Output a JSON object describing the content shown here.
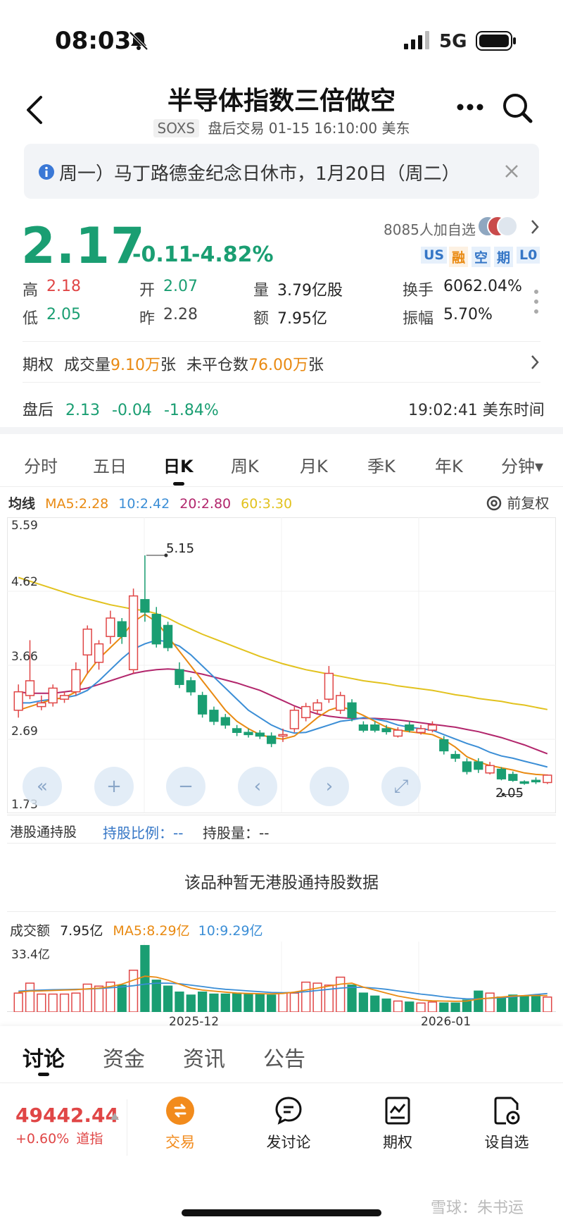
{
  "status": {
    "time": "08:03",
    "network": "5G"
  },
  "header": {
    "title": "半导体指数三倍做空",
    "ticker": "SOXS",
    "session_info": "盘后交易 01-15 16:10:00 美东"
  },
  "notice": {
    "text": "周一）马丁路德金纪念日休市，1月20日（周二）"
  },
  "quote": {
    "price": "2.17",
    "change": "-0.11",
    "change_pct": "-4.82%",
    "followers": "8085人加自选",
    "tags": [
      "US",
      "融",
      "空",
      "期",
      "L0"
    ]
  },
  "stats": {
    "high_label": "高",
    "high": "2.18",
    "open_label": "开",
    "open": "2.07",
    "volume_label": "量",
    "volume": "3.79亿股",
    "turnover_label": "换手",
    "turnover": "6062.04%",
    "low_label": "低",
    "low": "2.05",
    "prev_label": "昨",
    "prev": "2.28",
    "amount_label": "额",
    "amount": "7.95亿",
    "amplitude_label": "振幅",
    "amplitude": "5.70%"
  },
  "options": {
    "label": "期权",
    "vol_label": "成交量",
    "vol": "9.10万",
    "vol_unit": "张",
    "oi_label": "未平仓数",
    "oi": "76.00万",
    "oi_unit": "张"
  },
  "after_hours": {
    "label": "盘后",
    "price": "2.13",
    "change": "-0.04",
    "change_pct": "-1.84%",
    "time": "19:02:41 美东时间"
  },
  "period_tabs": [
    "分时",
    "五日",
    "日K",
    "周K",
    "月K",
    "季K",
    "年K",
    "分钟▾"
  ],
  "ma_legend": {
    "label": "均线",
    "ma5": "MA5:2.28",
    "ma10": "10:2.42",
    "ma20": "20:2.80",
    "ma60": "60:3.30",
    "adjust": "前复权"
  },
  "price_axis": [
    "5.59",
    "4.62",
    "3.66",
    "2.69",
    "1.73"
  ],
  "annotations": {
    "high": "5.15",
    "low": "2.05"
  },
  "hk_connect": {
    "label": "港股通持股",
    "ratio_label": "持股比例：",
    "ratio": "--",
    "qty_label": "持股量：",
    "qty": "--",
    "empty": "该品种暂无港股通持股数据"
  },
  "volume_panel": {
    "label": "成交额",
    "value": "7.95亿",
    "ma5": "MA5:8.29亿",
    "ma10": "10:9.29亿",
    "max": "33.4亿",
    "dates": [
      "2025-12",
      "2026-01"
    ]
  },
  "bottom_tabs": [
    "讨论",
    "资金",
    "资讯",
    "公告"
  ],
  "index": {
    "value": "49442.44",
    "change": "+0.60%",
    "name": "道指"
  },
  "nav": [
    {
      "label": "交易",
      "icon": "trade-icon"
    },
    {
      "label": "发讨论",
      "icon": "chat-icon"
    },
    {
      "label": "期权",
      "icon": "options-chart-icon"
    },
    {
      "label": "设自选",
      "icon": "add-watchlist-icon"
    }
  ],
  "watermark": "雪球：朱书运",
  "chart_data": {
    "type": "candlestick",
    "ylim": [
      1.73,
      5.59
    ],
    "candles": [
      {
        "o": 3.05,
        "c": 3.3,
        "h": 3.4,
        "l": 2.95
      },
      {
        "o": 3.25,
        "c": 3.45,
        "h": 4.0,
        "l": 3.2
      },
      {
        "o": 3.1,
        "c": 3.15,
        "h": 3.25,
        "l": 3.05
      },
      {
        "o": 3.15,
        "c": 3.35,
        "h": 3.4,
        "l": 3.1
      },
      {
        "o": 3.2,
        "c": 3.25,
        "h": 3.3,
        "l": 3.15
      },
      {
        "o": 3.3,
        "c": 3.6,
        "h": 3.7,
        "l": 3.25
      },
      {
        "o": 3.8,
        "c": 4.15,
        "h": 4.2,
        "l": 3.55
      },
      {
        "o": 3.7,
        "c": 3.95,
        "h": 4.0,
        "l": 3.6
      },
      {
        "o": 4.05,
        "c": 4.3,
        "h": 4.4,
        "l": 3.95
      },
      {
        "o": 4.25,
        "c": 4.05,
        "h": 4.3,
        "l": 3.95
      },
      {
        "o": 3.6,
        "c": 4.6,
        "h": 4.7,
        "l": 3.55
      },
      {
        "o": 4.55,
        "c": 4.38,
        "h": 5.15,
        "l": 4.25
      },
      {
        "o": 4.35,
        "c": 3.95,
        "h": 4.45,
        "l": 3.9
      },
      {
        "o": 4.2,
        "c": 3.9,
        "h": 4.25,
        "l": 3.85
      },
      {
        "o": 3.6,
        "c": 3.4,
        "h": 3.7,
        "l": 3.35
      },
      {
        "o": 3.45,
        "c": 3.3,
        "h": 3.5,
        "l": 3.25
      },
      {
        "o": 3.25,
        "c": 3.0,
        "h": 3.3,
        "l": 2.95
      },
      {
        "o": 3.05,
        "c": 2.9,
        "h": 3.1,
        "l": 2.85
      },
      {
        "o": 2.95,
        "c": 2.85,
        "h": 3.0,
        "l": 2.8
      },
      {
        "o": 2.8,
        "c": 2.75,
        "h": 2.85,
        "l": 2.7
      },
      {
        "o": 2.75,
        "c": 2.72,
        "h": 2.8,
        "l": 2.68
      },
      {
        "o": 2.74,
        "c": 2.7,
        "h": 2.78,
        "l": 2.66
      },
      {
        "o": 2.7,
        "c": 2.6,
        "h": 2.75,
        "l": 2.55
      },
      {
        "o": 2.7,
        "c": 2.72,
        "h": 2.8,
        "l": 2.62
      },
      {
        "o": 2.8,
        "c": 3.05,
        "h": 3.1,
        "l": 2.75
      },
      {
        "o": 2.95,
        "c": 3.1,
        "h": 3.15,
        "l": 2.9
      },
      {
        "o": 3.05,
        "c": 3.15,
        "h": 3.2,
        "l": 3.0
      },
      {
        "o": 3.2,
        "c": 3.55,
        "h": 3.65,
        "l": 3.15
      },
      {
        "o": 3.05,
        "c": 3.25,
        "h": 3.3,
        "l": 3.0
      },
      {
        "o": 3.15,
        "c": 2.95,
        "h": 3.2,
        "l": 2.9
      },
      {
        "o": 2.85,
        "c": 2.78,
        "h": 2.9,
        "l": 2.75
      },
      {
        "o": 2.85,
        "c": 2.78,
        "h": 2.9,
        "l": 2.75
      },
      {
        "o": 2.8,
        "c": 2.76,
        "h": 2.85,
        "l": 2.72
      },
      {
        "o": 2.7,
        "c": 2.78,
        "h": 2.82,
        "l": 2.68
      },
      {
        "o": 2.85,
        "c": 2.78,
        "h": 2.9,
        "l": 2.75
      },
      {
        "o": 2.75,
        "c": 2.8,
        "h": 2.85,
        "l": 2.72
      },
      {
        "o": 2.78,
        "c": 2.85,
        "h": 2.9,
        "l": 2.75
      },
      {
        "o": 2.65,
        "c": 2.5,
        "h": 2.7,
        "l": 2.45
      },
      {
        "o": 2.45,
        "c": 2.4,
        "h": 2.5,
        "l": 2.35
      },
      {
        "o": 2.35,
        "c": 2.22,
        "h": 2.4,
        "l": 2.18
      },
      {
        "o": 2.35,
        "c": 2.25,
        "h": 2.4,
        "l": 2.2
      },
      {
        "o": 2.2,
        "c": 2.3,
        "h": 2.35,
        "l": 2.18
      },
      {
        "o": 2.25,
        "c": 2.12,
        "h": 2.28,
        "l": 2.1
      },
      {
        "o": 2.18,
        "c": 2.1,
        "h": 2.22,
        "l": 2.08
      },
      {
        "o": 2.08,
        "c": 2.06,
        "h": 2.1,
        "l": 2.04
      },
      {
        "o": 2.1,
        "c": 2.08,
        "h": 2.14,
        "l": 2.05
      },
      {
        "o": 2.07,
        "c": 2.17,
        "h": 2.18,
        "l": 2.05
      }
    ],
    "ma5": [
      3.05,
      3.1,
      3.15,
      3.2,
      3.22,
      3.3,
      3.55,
      3.75,
      3.9,
      4.05,
      4.25,
      4.35,
      4.25,
      4.05,
      3.85,
      3.65,
      3.45,
      3.25,
      3.05,
      2.9,
      2.8,
      2.72,
      2.68,
      2.66,
      2.7,
      2.82,
      2.95,
      3.05,
      3.1,
      3.05,
      2.98,
      2.9,
      2.82,
      2.78,
      2.76,
      2.74,
      2.72,
      2.65,
      2.55,
      2.42,
      2.35,
      2.3,
      2.27,
      2.24,
      2.2,
      2.18,
      2.17
    ],
    "ma10": [
      3.15,
      3.15,
      3.18,
      3.2,
      3.22,
      3.25,
      3.32,
      3.45,
      3.6,
      3.75,
      3.88,
      3.95,
      4.0,
      3.98,
      3.92,
      3.8,
      3.65,
      3.5,
      3.35,
      3.2,
      3.05,
      2.95,
      2.85,
      2.78,
      2.74,
      2.75,
      2.8,
      2.85,
      2.9,
      2.92,
      2.95,
      2.93,
      2.9,
      2.85,
      2.82,
      2.8,
      2.78,
      2.72,
      2.66,
      2.6,
      2.55,
      2.48,
      2.43,
      2.4,
      2.36,
      2.32,
      2.28
    ],
    "ma20": [
      3.3,
      3.28,
      3.28,
      3.28,
      3.3,
      3.32,
      3.35,
      3.4,
      3.45,
      3.5,
      3.55,
      3.58,
      3.6,
      3.61,
      3.6,
      3.57,
      3.54,
      3.5,
      3.46,
      3.42,
      3.37,
      3.32,
      3.25,
      3.18,
      3.11,
      3.05,
      3.0,
      2.97,
      2.95,
      2.94,
      2.94,
      2.94,
      2.93,
      2.92,
      2.9,
      2.88,
      2.86,
      2.84,
      2.82,
      2.79,
      2.76,
      2.72,
      2.68,
      2.63,
      2.58,
      2.52,
      2.46
    ],
    "ma60": [
      4.85,
      4.8,
      4.75,
      4.7,
      4.65,
      4.6,
      4.56,
      4.52,
      4.48,
      4.45,
      4.42,
      4.4,
      4.36,
      4.3,
      4.22,
      4.15,
      4.08,
      4.02,
      3.96,
      3.9,
      3.84,
      3.78,
      3.73,
      3.68,
      3.64,
      3.6,
      3.57,
      3.54,
      3.51,
      3.48,
      3.45,
      3.43,
      3.41,
      3.38,
      3.36,
      3.34,
      3.32,
      3.29,
      3.26,
      3.24,
      3.21,
      3.19,
      3.17,
      3.14,
      3.12,
      3.09,
      3.06
    ],
    "volume": [
      9.5,
      14.5,
      9.0,
      9.0,
      9.0,
      9.5,
      14.0,
      13.0,
      15.0,
      13.5,
      21.0,
      33.4,
      16.0,
      13.0,
      10.0,
      8.5,
      10.0,
      9.0,
      9.0,
      9.5,
      9.0,
      9.0,
      8.5,
      9.5,
      9.5,
      15.0,
      14.5,
      13.5,
      17.5,
      13.5,
      9.5,
      8.0,
      6.5,
      5.5,
      5.0,
      4.5,
      5.0,
      4.5,
      4.5,
      6.0,
      10.5,
      9.5,
      7.5,
      8.5,
      8.0,
      8.5,
      7.5
    ],
    "vol_ma5": [
      10,
      10.5,
      10.6,
      10.8,
      11,
      11.2,
      11.6,
      12,
      12.8,
      14,
      16,
      18,
      17.5,
      16,
      14,
      12,
      11,
      10.5,
      10,
      9.5,
      9.3,
      9.2,
      9.1,
      9.3,
      10,
      11,
      12,
      13,
      14,
      14.5,
      12.5,
      11,
      9.5,
      8,
      7,
      6,
      5.6,
      5.5,
      5.4,
      5.5,
      6.5,
      7,
      7.5,
      8,
      8.2,
      8.3,
      8.29
    ],
    "vol_ma10": [
      10.5,
      10.8,
      11,
      11.2,
      11.3,
      11.4,
      11.5,
      11.8,
      12.2,
      12.6,
      13.2,
      14,
      14.5,
      14.5,
      14.2,
      13.5,
      12.8,
      12,
      11.4,
      11,
      10.6,
      10.2,
      9.8,
      9.7,
      9.8,
      10.2,
      10.8,
      11.4,
      12,
      12.4,
      12.4,
      12,
      11.4,
      10.6,
      9.8,
      9,
      8.4,
      7.6,
      7,
      6.6,
      6.6,
      6.9,
      7.2,
      7.6,
      8.2,
      8.8,
      9.29
    ]
  }
}
